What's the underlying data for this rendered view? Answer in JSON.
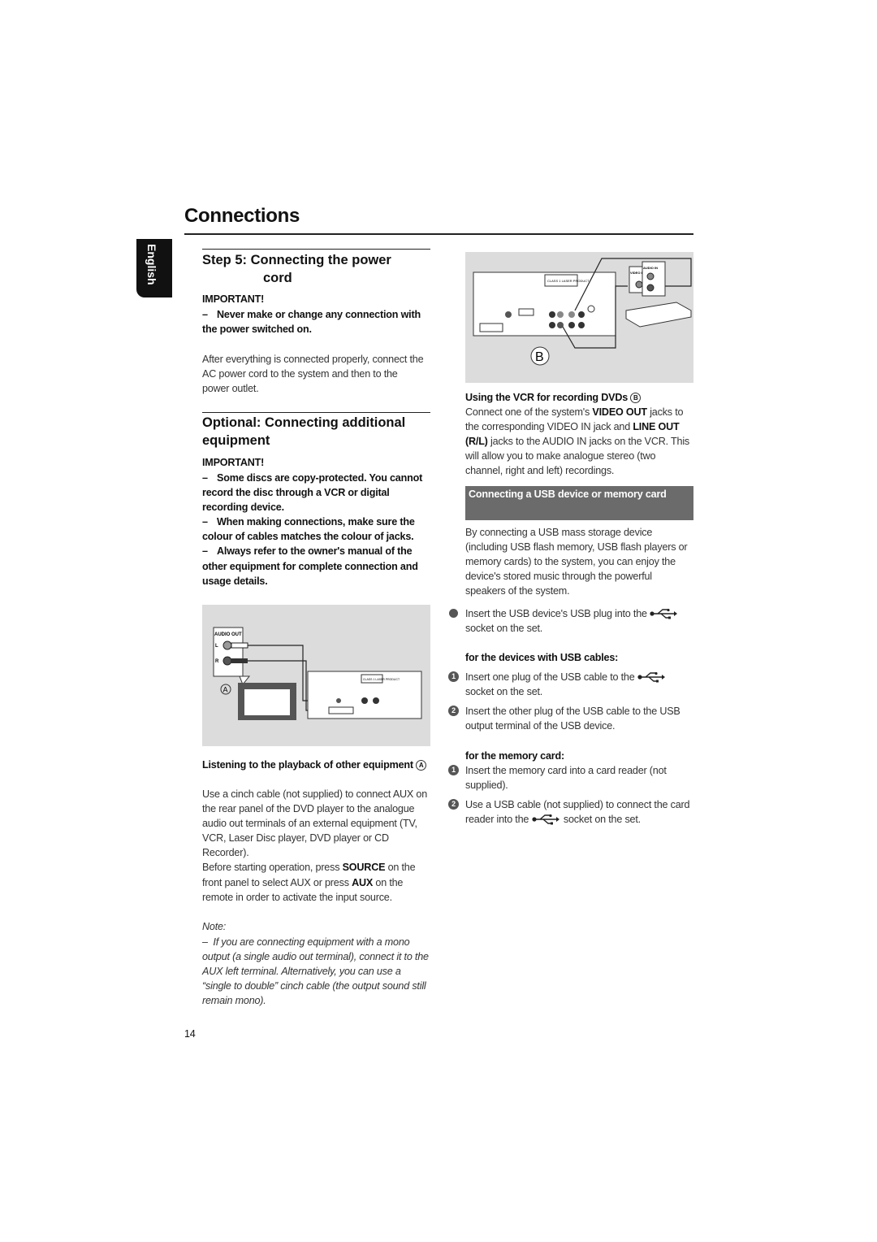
{
  "page_title": "Connections",
  "language_tab": "English",
  "page_number": "14",
  "left": {
    "step5": {
      "heading_line1": "Step 5:  Connecting the power",
      "heading_line2": "cord",
      "important": "IMPORTANT!",
      "warning": "Never make or change any connection with the power switched on.",
      "body": "After everything is connected properly, connect the AC power cord to the system and then to the power outlet."
    },
    "optional": {
      "heading": "Optional: Connecting additional equipment",
      "important": "IMPORTANT!",
      "warnings": [
        "Some discs are copy-protected. You cannot record the disc through a VCR or digital recording device.",
        "When making connections, make sure the colour of cables matches the colour of jacks.",
        "Always refer to the owner's manual of the other equipment for complete connection and usage details."
      ]
    },
    "diagram_a": {
      "label": "A",
      "audio_out": "AUDIO OUT",
      "l": "L",
      "r": "R",
      "class_label": "CLASS 1 LASER PRODUCT"
    },
    "listening": {
      "heading": "Listening to the playback of other equipment",
      "heading_marker": "A",
      "body1": "Use a cinch cable (not supplied) to connect AUX on the rear panel of the DVD player to the analogue audio out terminals of an external equipment (TV, VCR, Laser Disc player, DVD player or CD Recorder).",
      "body2_a": "Before starting operation, press ",
      "body2_source": "SOURCE",
      "body2_b": " on the front panel to select AUX or press ",
      "body2_aux": "AUX",
      "body2_c": " on the remote in order to activate the input source."
    },
    "note": {
      "label": "Note:",
      "text": "If you are connecting equipment with a mono output (a single audio out terminal), connect it to the AUX left terminal. Alternatively, you can use a “single to double” cinch cable (the output sound still remain mono)."
    }
  },
  "right": {
    "diagram_b": {
      "label": "B",
      "video_in": "VIDEO IN",
      "audio_in": "AUDIO IN",
      "class_label": "CLASS 1 LASER PRODUCT"
    },
    "vcr": {
      "heading": "Using the VCR for recording DVDs",
      "heading_marker": "B",
      "t1": "Connect one of the system's ",
      "video_out": "VIDEO OUT",
      "t2": " jacks to the corresponding VIDEO IN jack and ",
      "line_out": "LINE OUT (R/L)",
      "t3": " jacks to the AUDIO IN jacks on the VCR. This will allow you to make analogue stereo (two channel, right and left) recordings."
    },
    "usb": {
      "banner": "Connecting a USB device or memory card",
      "intro": "By connecting a USB mass storage device (including USB flash memory, USB flash players or memory cards) to the system, you can enjoy the device's stored music through the powerful speakers of the system.",
      "bullet_a": "Insert the USB device's USB plug into the",
      "bullet_b": "socket on the set.",
      "cables_heading": "for the devices with USB cables:",
      "cables_step1_a": "Insert one plug of the USB cable to the",
      "cables_step1_b": "socket on the set.",
      "cables_step2": "Insert the other plug of the USB cable to the USB output terminal of the USB device.",
      "card_heading": "for the memory card:",
      "card_step1": "Insert the memory card into a card reader (not supplied).",
      "card_step2_a": "Use a USB cable (not supplied) to connect the card reader into the",
      "card_step2_b": "socket on the set.",
      "step_numbers": [
        "1",
        "2"
      ]
    }
  },
  "colors": {
    "banner_bg": "#6b6b6b",
    "diagram_bg": "#dcdcdc",
    "tab_bg": "#111111"
  }
}
